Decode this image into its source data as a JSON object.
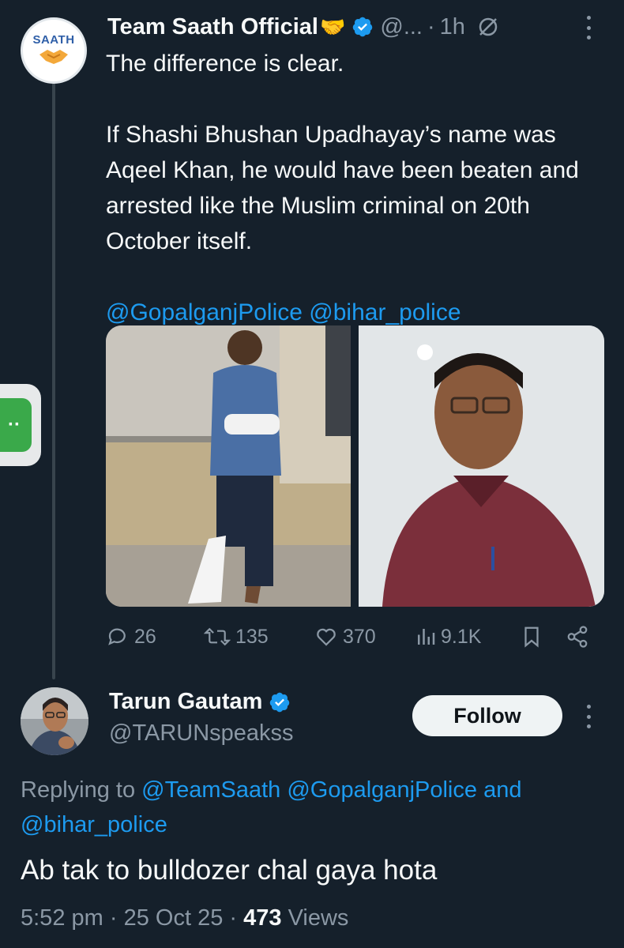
{
  "tweet": {
    "author_name": "Team Saath Official",
    "author_emoji": "🤝",
    "handle": "@...",
    "separator": "·",
    "time": "1h",
    "avatar_logo_text": "SAATH",
    "text_lines": [
      "The difference is clear.",
      "If Shashi Bhushan Upadhayay’s name was Aqeel Khan, he would have been beaten and arrested like the Muslim criminal on 20th October itself."
    ],
    "mentions": [
      "@GopalganjPolice",
      "@bihar_police"
    ],
    "stats": {
      "replies": "26",
      "reposts": "135",
      "likes": "370",
      "views": "9.1K"
    },
    "icons": [
      "verified-badge-icon",
      "grok-icon",
      "more-options-icon",
      "reply-icon",
      "repost-icon",
      "like-icon",
      "views-icon",
      "bookmark-icon",
      "share-icon"
    ]
  },
  "reply": {
    "author_name": "Tarun Gautam",
    "handle": "@TARUNspeakss",
    "follow_label": "Follow",
    "replying_prefix": "Replying to",
    "replying_to": [
      "@TeamSaath",
      "@GopalganjPolice"
    ],
    "replying_and": "and",
    "replying_last": "@bihar_police",
    "text": "Ab tak to bulldozer chal gaya hota",
    "time": "5:52 pm",
    "date": "25 Oct 25",
    "separator": "·",
    "views_count": "473",
    "views_label": "Views"
  },
  "colors": {
    "background": "#15202b",
    "text": "#f7f9f9",
    "muted": "#8b98a5",
    "link": "#1d9bf0",
    "verified": "#1d9bf0"
  }
}
